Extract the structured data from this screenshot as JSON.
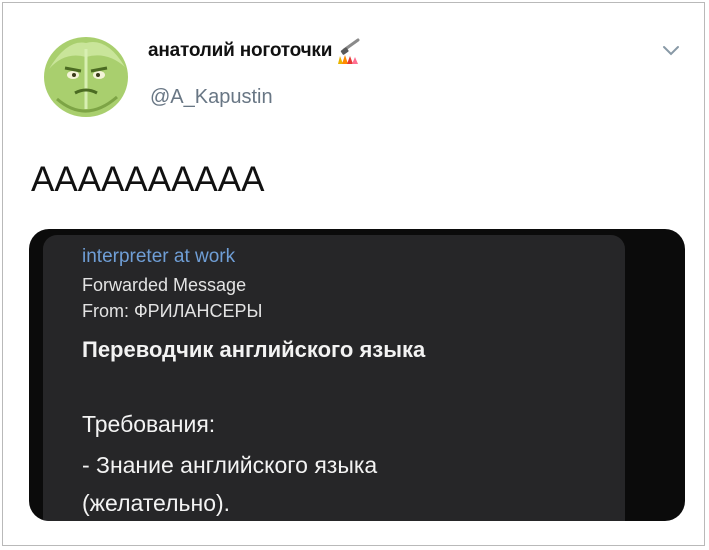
{
  "tweet": {
    "display_name": "анатолий ноготочки",
    "handle": "@A_Kapustin",
    "text": "AAAAAAAAAA",
    "avatar_icon": "cabbage-avatar-icon",
    "emoji_icon": "nail-polish-emoji-icon",
    "menu_icon": "chevron-down-icon"
  },
  "media": {
    "channel": "interpreter at work",
    "forwarded": "Forwarded Message",
    "from": "From: ФРИЛАНСЕРЫ",
    "headline": "Переводчик английского языка",
    "requirements_title": "Требования:",
    "requirement_line1": "- Знание английского языка",
    "requirement_line2": "(желательно)."
  },
  "colors": {
    "channel_link": "#6f9ed6",
    "handle": "#687684",
    "media_bg": "#0b0b0b",
    "bubble_bg": "#262628"
  }
}
